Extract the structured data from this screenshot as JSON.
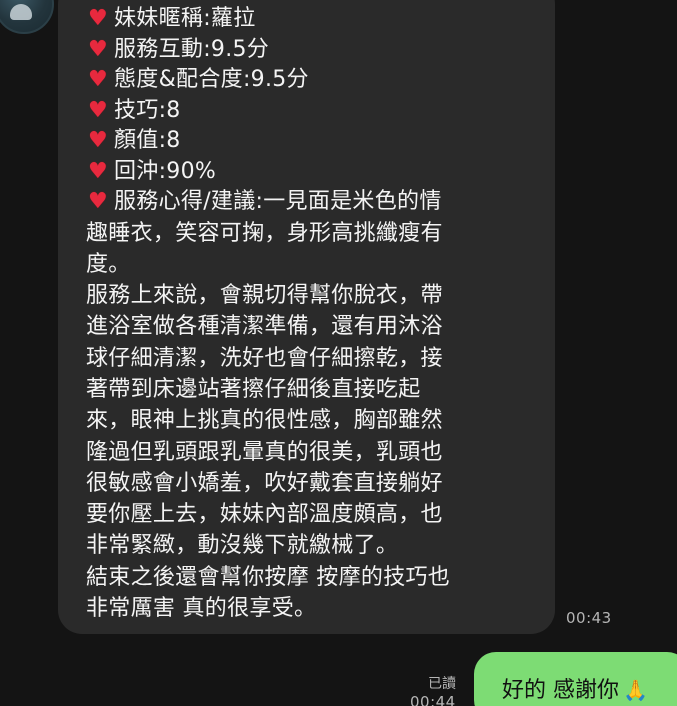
{
  "chat": {
    "avatar_icon": "user-avatar-icon",
    "incoming": {
      "items": [
        {
          "icon": "heart-icon",
          "text": "妹妹暱稱:蘿拉"
        },
        {
          "icon": "heart-icon",
          "text": "服務互動:9.5分"
        },
        {
          "icon": "heart-icon",
          "text": "態度&配合度:9.5分"
        },
        {
          "icon": "heart-icon",
          "text": "技巧:8"
        },
        {
          "icon": "heart-icon",
          "text": "顏值:8"
        },
        {
          "icon": "heart-icon",
          "text": "回沖:90%"
        },
        {
          "icon": "heart-icon",
          "text": "服務心得/建議:一見面是米色的情"
        }
      ],
      "paragraph": "趣睡衣，笑容可掬，身形高挑纖瘦有\n度。\n服務上來說，會親切得幫你脫衣，帶\n進浴室做各種清潔準備，還有用沐浴\n球仔細清潔，洗好也會仔細擦乾，接\n著帶到床邊站著擦仔細後直接吃起\n來，眼神上挑真的很性感，胸部雖然\n隆過但乳頭跟乳暈真的很美，乳頭也\n很敏感會小嬌羞，吹好戴套直接躺好\n要你壓上去，妹妹內部溫度頗高，也\n非常緊緻，動沒幾下就繳械了。\n結束之後還會幫你按摩 按摩的技巧也\n非常厲害 真的很享受。",
      "time": "00:43"
    },
    "outgoing": {
      "text": "好的 感謝你",
      "emoji": "🙏",
      "read_label": "已讀",
      "time": "00:44"
    },
    "colors": {
      "background": "#141414",
      "incoming_bubble": "#2a2a2a",
      "outgoing_bubble": "#7ddc74",
      "heart": "#e8293e"
    }
  }
}
